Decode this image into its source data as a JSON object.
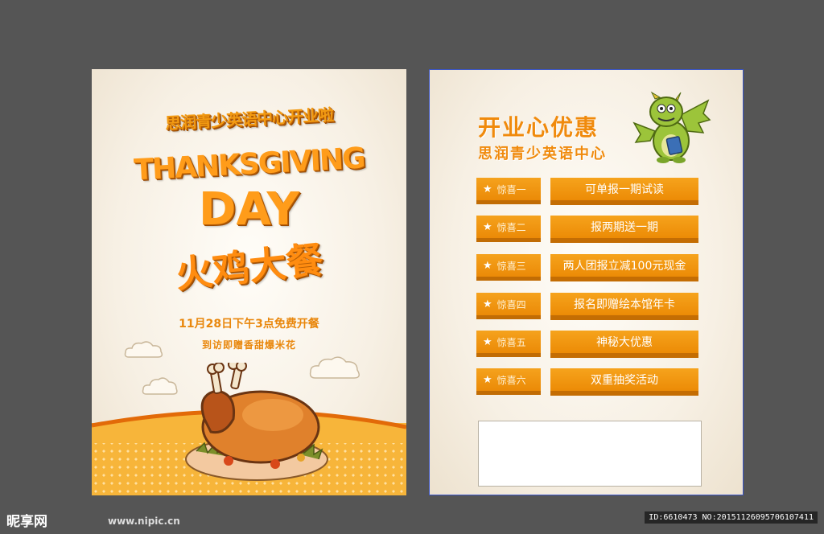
{
  "front": {
    "title": "思润青少英语中心开业啦",
    "thanks": "THANKSGIVING",
    "day": "DAY",
    "feast": "火鸡大餐",
    "time_text": "11月28日下午3点免费开餐",
    "gift_text": "到访即赠香甜爆米花"
  },
  "back": {
    "title_line1": "开业心优惠",
    "title_line2": "思润青少英语中心",
    "offers": [
      {
        "tag": "惊喜一",
        "text": "可单报一期试读"
      },
      {
        "tag": "惊喜二",
        "text": "报两期送一期"
      },
      {
        "tag": "惊喜三",
        "text": "两人团报立减100元现金"
      },
      {
        "tag": "惊喜四",
        "text": "报名即赠绘本馆年卡"
      },
      {
        "tag": "惊喜五",
        "text": "神秘大优惠"
      },
      {
        "tag": "惊喜六",
        "text": "双重抽奖活动"
      }
    ]
  },
  "watermark": {
    "logo": "昵享网",
    "url": "www.nipic.cn",
    "id": "ID:6610473 NO:20151126095706107411"
  },
  "colors": {
    "canvas": "#555555",
    "orange": "#f29a12",
    "orange_dark": "#c46d03",
    "paper": "#f7f0e4"
  }
}
